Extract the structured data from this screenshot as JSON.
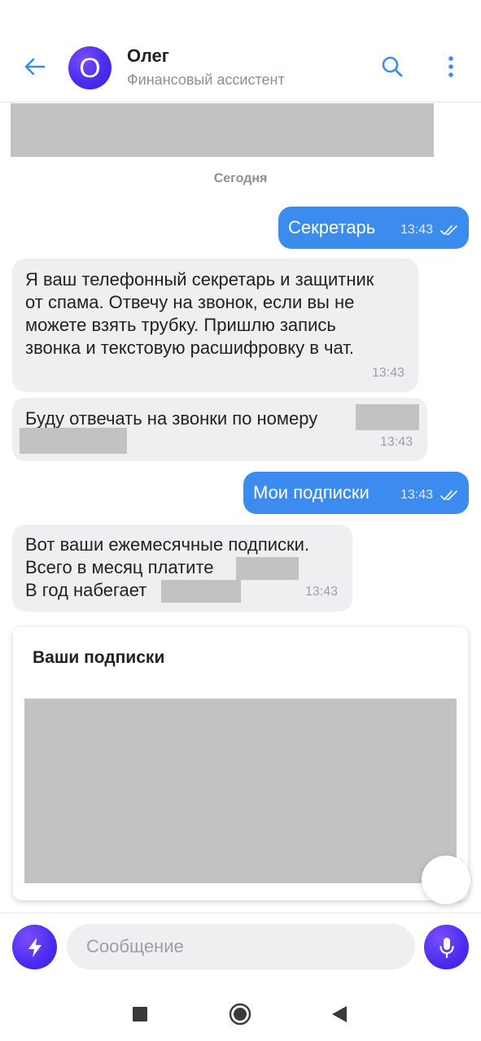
{
  "header": {
    "avatar_letter": "О",
    "name": "Олег",
    "subtitle": "Финансовый ассистент",
    "icons": {
      "back": "arrow-left-icon",
      "search": "search-icon",
      "more": "more-vertical-icon"
    },
    "accent_color": "#3c8cf0",
    "avatar_color": "#4c2cf0"
  },
  "chat": {
    "date_separator": "Сегодня",
    "messages": [
      {
        "direction": "out",
        "lines": [
          "Секретарь"
        ],
        "time": "13:43",
        "status": "read"
      },
      {
        "direction": "in",
        "lines": [
          "Я ваш телефонный секретарь и защитник",
          "от спама. Отвечу на звонок, если вы не",
          "можете взять трубку. Пришлю запись",
          "звонка и текстовую расшифровку в чат."
        ],
        "time": "13:43"
      },
      {
        "direction": "in",
        "lines": [
          "Буду отвечать на звонки по номеру"
        ],
        "time": "13:43"
      },
      {
        "direction": "out",
        "lines": [
          "Мои подписки"
        ],
        "time": "13:43",
        "status": "read"
      },
      {
        "direction": "in",
        "lines": [
          "Вот ваши ежемесячные подписки.",
          "Всего в месяц платите",
          "В год набегает"
        ],
        "time": "13:43"
      }
    ],
    "card": {
      "title": "Ваши подписки"
    }
  },
  "composer": {
    "placeholder": "Сообщение",
    "icons": {
      "left": "bolt-icon",
      "right": "microphone-icon"
    }
  },
  "navbar": {
    "icons": {
      "recents": "square-icon",
      "home": "circle-icon",
      "back": "triangle-back-icon"
    }
  }
}
